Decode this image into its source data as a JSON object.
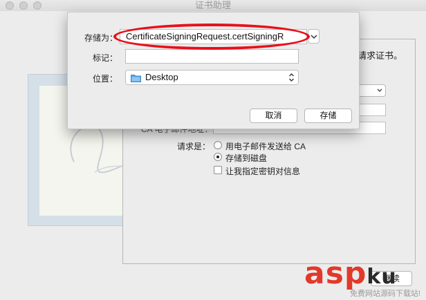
{
  "window": {
    "title": "证书助理"
  },
  "background_form": {
    "description_text": "请求证书。",
    "ca_email_label": "CA 电子邮件地址：",
    "request_label": "请求是：",
    "option_email": "用电子邮件发送给 CA",
    "option_save": "存储到磁盘",
    "option_keypair": "让我指定密钥对信息",
    "selected_option": "存储到磁盘",
    "continue_button": "继续"
  },
  "save_sheet": {
    "save_as_label": "存储为：",
    "filename": "CertificateSigningRequest.certSigningR",
    "tags_label": "标记：",
    "tags_value": "",
    "where_label": "位置：",
    "location": "Desktop",
    "cancel_label": "取消",
    "save_label": "存储"
  },
  "watermark": {
    "main": "asp",
    "ku": "ku",
    "sub": "免费网站源码下载站!"
  },
  "colors": {
    "highlight_ellipse": "#e8101a",
    "folder_icon": "#5aa7e8",
    "watermark_red": "#e03a2a"
  }
}
